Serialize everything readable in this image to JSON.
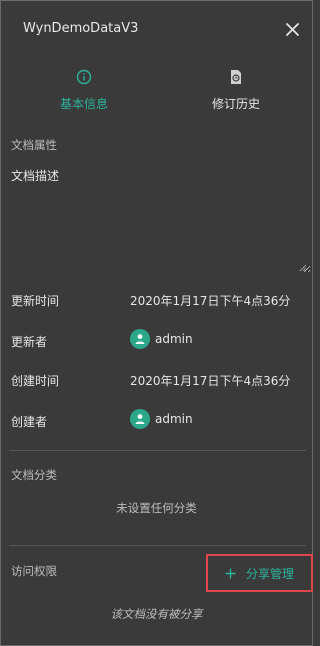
{
  "window": {
    "title": "WynDemoDataV3",
    "close_icon": "close-icon"
  },
  "tabs": [
    {
      "label": "基本信息",
      "icon": "info-circle-icon",
      "active": true
    },
    {
      "label": "修订历史",
      "icon": "history-document-icon",
      "active": false
    }
  ],
  "properties": {
    "section_label": "文档属性",
    "description_label": "文档描述",
    "description_value": ""
  },
  "meta": {
    "updated_time_label": "更新时间",
    "updated_time_value": "2020年1月17日下午4点36分",
    "updater_label": "更新者",
    "updater_value": "admin",
    "created_time_label": "创建时间",
    "created_time_value": "2020年1月17日下午4点36分",
    "creator_label": "创建者",
    "creator_value": "admin"
  },
  "category": {
    "section_label": "文档分类",
    "empty_text": "未设置任何分类"
  },
  "permissions": {
    "section_label": "访问权限",
    "share_button_label": "分享管理",
    "empty_text": "该文档没有被分享"
  },
  "colors": {
    "accent": "#2cb49a",
    "highlight_box": "#e0474c",
    "background": "#3a3a3a"
  }
}
